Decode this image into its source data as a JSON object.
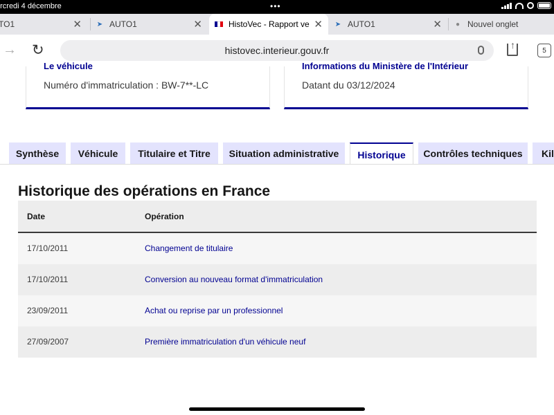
{
  "status_bar": {
    "time": "ercredi 4 décembre"
  },
  "browser_tabs": [
    {
      "label": "TO1"
    },
    {
      "label": "AUTO1"
    },
    {
      "label": "HistoVec - Rapport ve"
    },
    {
      "label": "AUTO1"
    },
    {
      "label": "Nouvel onglet"
    }
  ],
  "address_bar": {
    "url": "histovec.interieur.gouv.fr",
    "tab_count": "5"
  },
  "cards": [
    {
      "title": "Le véhicule",
      "text": "Numéro d'immatriculation : BW-7**-LC"
    },
    {
      "title": "Informations du Ministère de l'Intérieur",
      "text": "Datant du 03/12/2024"
    }
  ],
  "tabs": [
    {
      "label": "Synthèse"
    },
    {
      "label": "Véhicule"
    },
    {
      "label": "Titulaire et Titre"
    },
    {
      "label": "Situation administrative"
    },
    {
      "label": "Historique"
    },
    {
      "label": "Contrôles techniques"
    },
    {
      "label": "Kil"
    }
  ],
  "section": {
    "title": "Historique des opérations en France",
    "columns": [
      "Date",
      "Opération"
    ],
    "rows": [
      {
        "date": "17/10/2011",
        "operation": "Changement de titulaire"
      },
      {
        "date": "17/10/2011",
        "operation": "Conversion au nouveau format d'immatriculation"
      },
      {
        "date": "23/09/2011",
        "operation": "Achat ou reprise par un professionnel"
      },
      {
        "date": "27/09/2007",
        "operation": "Première immatriculation d'un véhicule neuf"
      }
    ]
  },
  "colors": {
    "accent": "#000091",
    "tab_bg": "#e3e3fd"
  }
}
